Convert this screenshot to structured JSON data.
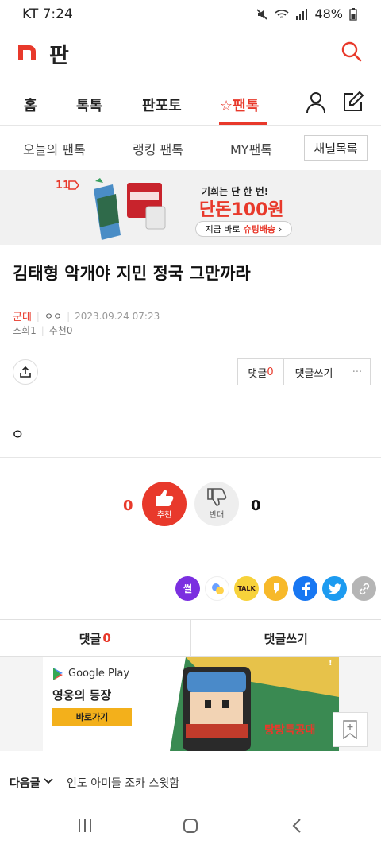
{
  "status_bar": {
    "carrier": "KT 7:24",
    "battery": "48%"
  },
  "header": {
    "logo_text": "판"
  },
  "top_nav": {
    "tabs": [
      {
        "label": "홈"
      },
      {
        "label": "톡톡"
      },
      {
        "label": "판포토"
      },
      {
        "label": "☆팬톡",
        "active": true
      }
    ]
  },
  "sub_nav": {
    "items": [
      "오늘의 팬톡",
      "랭킹 팬톡",
      "MY팬톡"
    ],
    "channel_button": "채널목록"
  },
  "banner": {
    "tag": "11",
    "headline": "기회는 단 한 번!",
    "big_text": "단돈100원",
    "cta": "지금 바로",
    "cta_brand": "슈팅배송",
    "cta_arrow": "›"
  },
  "post": {
    "title": "김태형 악개야 지민 정국 그만까라",
    "category": "군대",
    "author": "ㅇㅇ",
    "datetime": "2023.09.24 07:23",
    "views": "조회1",
    "recommends": "추천0",
    "body": "ㅇ"
  },
  "actions": {
    "comment_label": "댓글",
    "comment_count": "0",
    "write_comment": "댓글쓰기",
    "more": "···"
  },
  "vote": {
    "up_count": "0",
    "up_label": "추천",
    "down_count": "0",
    "down_label": "반대"
  },
  "share_icons": [
    "ssul-icon",
    "blob-icon",
    "kakaotalk-icon",
    "kakaostory-icon",
    "facebook-icon",
    "twitter-icon",
    "link-icon"
  ],
  "share_labels": {
    "ssul": "썰",
    "talk": "TALK"
  },
  "comment_bar": {
    "comments_label": "댓글",
    "comments_count": "0",
    "write_label": "댓글쓰기"
  },
  "ad": {
    "store": "Google Play",
    "title": "영웅의 등장",
    "cta": "바로가기",
    "game": "탕탕특공대",
    "badge": "!"
  },
  "next_post": {
    "label": "다음글",
    "title": "인도 아미들 조카 스윗함"
  },
  "colors": {
    "accent": "#e8392b",
    "kakao_yellow": "#f7d23a",
    "facebook": "#1877f2",
    "twitter": "#1d9bf0"
  }
}
